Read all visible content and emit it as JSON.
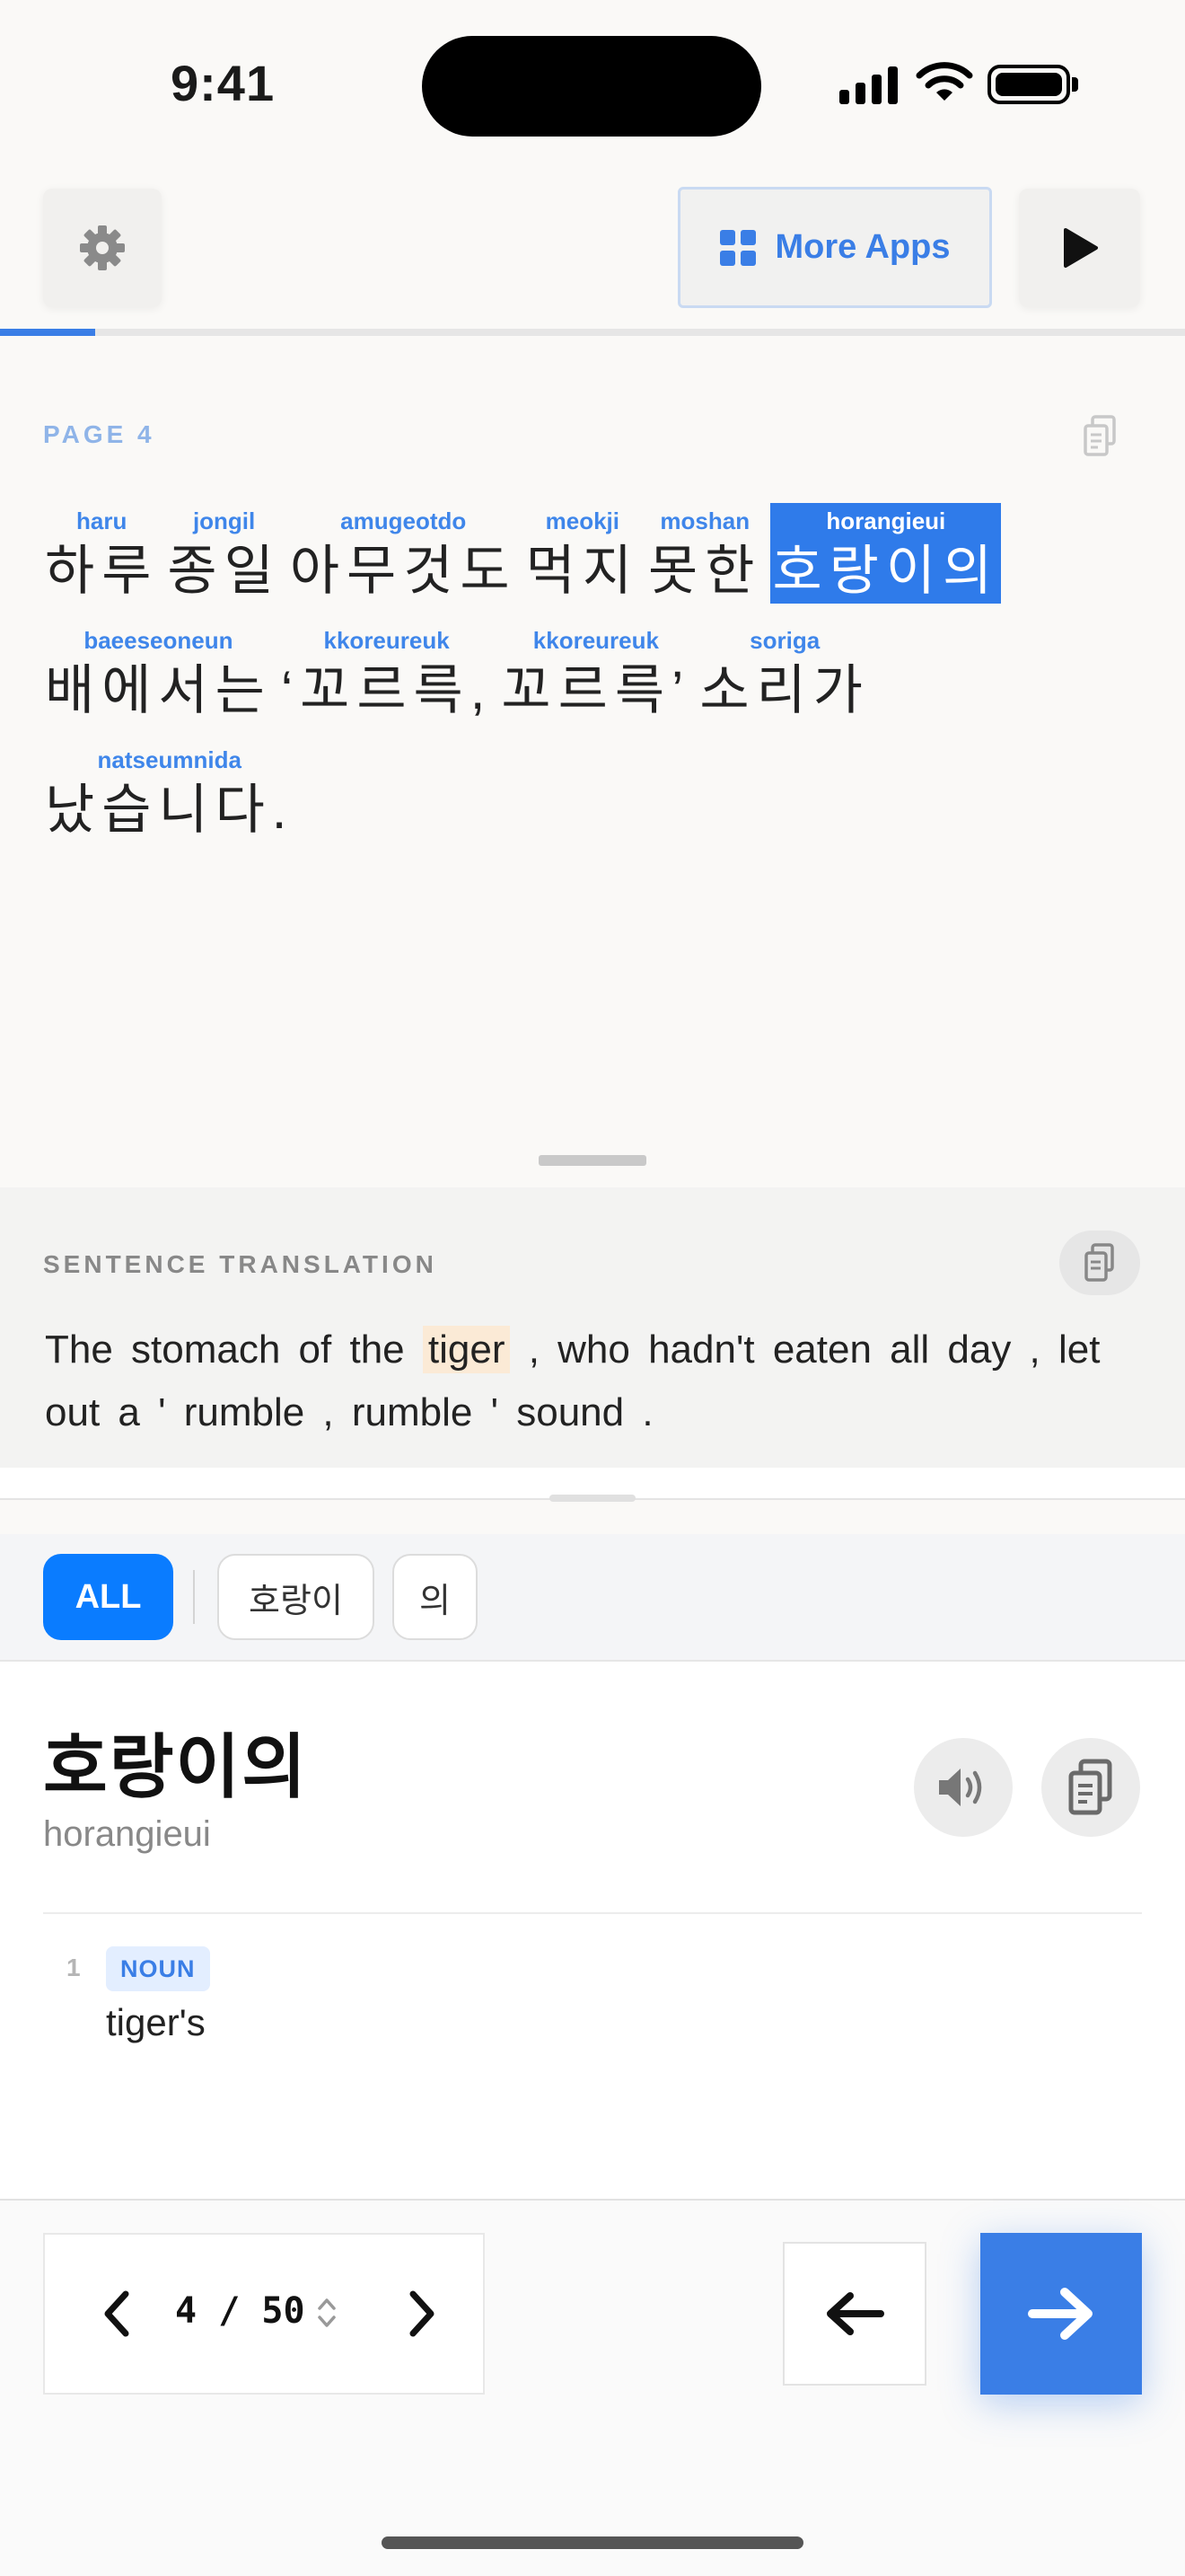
{
  "status_bar": {
    "time": "9:41"
  },
  "toolbar": {
    "more_apps_label": "More Apps",
    "progress_fraction": 0.08
  },
  "reader": {
    "page_label": "PAGE 4",
    "lines": [
      [
        {
          "rom": "haru",
          "kor": "하루"
        },
        {
          "rom": "jongil",
          "kor": "종일"
        },
        {
          "rom": "amugeotdo",
          "kor": "아무것도"
        },
        {
          "rom": "meokji",
          "kor": "먹지"
        },
        {
          "rom": "moshan",
          "kor": "못한"
        },
        {
          "rom": "horangieui",
          "kor": "호랑이의",
          "selected": true
        }
      ],
      [
        {
          "rom": "baeeseoneun",
          "kor": "배에서는"
        },
        {
          "rom": "kkoreureuk",
          "kor": "‘꼬르륵,"
        },
        {
          "rom": "kkoreureuk",
          "kor": "꼬르륵’"
        },
        {
          "rom": "soriga",
          "kor": "소리가"
        }
      ],
      [
        {
          "rom": "natseumnida",
          "kor": "났습니다."
        }
      ]
    ]
  },
  "translation": {
    "label": "SENTENCE TRANSLATION",
    "before": "The stomach of the ",
    "highlight": "tiger",
    "after": " , who hadn't eaten all day , let out a ' rumble , rumble ' sound ."
  },
  "filters": {
    "all_label": "ALL",
    "chips": [
      "호랑이",
      "의"
    ]
  },
  "dictionary": {
    "headword": "호랑이의",
    "romanization": "horangieui",
    "senses": [
      {
        "number": "1",
        "pos": "NOUN",
        "gloss": "tiger's"
      }
    ]
  },
  "pager": {
    "current": "4",
    "separator": "/",
    "total": "50"
  },
  "icons": {
    "settings": "gear-icon",
    "more_apps": "grid-icon",
    "play": "play-icon",
    "copy": "copy-icon",
    "speaker": "speaker-icon",
    "prev": "chevron-left-icon",
    "next": "chevron-right-icon",
    "sort": "sort-icon",
    "back": "arrow-left-icon",
    "forward": "arrow-right-icon"
  },
  "colors": {
    "accent": "#3a7ee6",
    "chip_active": "#0a7cff",
    "highlight": "#fbead6",
    "selection": "#2f7bea"
  }
}
